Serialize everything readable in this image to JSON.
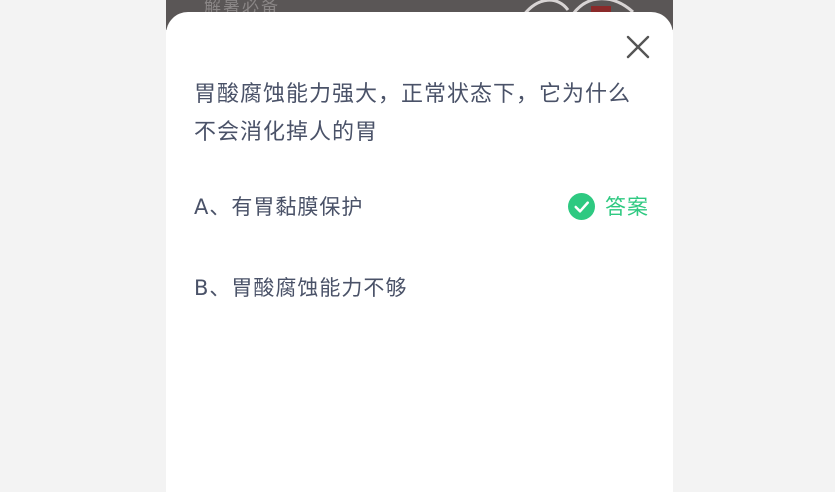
{
  "background_header": {
    "text": "解暑必备"
  },
  "quiz": {
    "question": "胃酸腐蚀能力强大，正常状态下，它为什么不会消化掉人的胃",
    "options": [
      {
        "text": "A、有胃黏膜保护",
        "is_answer": true
      },
      {
        "text": "B、胃酸腐蚀能力不够",
        "is_answer": false
      }
    ],
    "answer_label": "答案"
  },
  "colors": {
    "question_text": "#4a5268",
    "answer_green": "#2ec981",
    "close_icon": "#555555"
  },
  "icons": {
    "close": "close-icon",
    "check": "check-circle-icon"
  }
}
